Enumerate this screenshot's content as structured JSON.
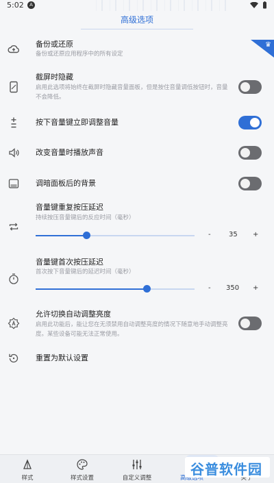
{
  "status_bar": {
    "time": "5:02",
    "app_icon": "A"
  },
  "header": {
    "title": "高级选项"
  },
  "colors": {
    "accent": "#2f6fd6",
    "toggle_off": "#6b6c70",
    "watermark": "#3a8dde"
  },
  "settings": [
    {
      "icon": "cloud-upload-icon",
      "title": "备份或还原",
      "subtitle": "备份或还原应用程序中的所有设定"
    },
    {
      "icon": "phone-screenshot-icon",
      "title": "截屏时隐藏",
      "subtitle": "启用此选项将始终在截屏时隐藏音量面板，但是按住音量调低按钮时，音量不会降低。",
      "toggle": false
    },
    {
      "icon": "plus-minus-icon",
      "title": "按下音量键立即调整音量",
      "toggle": true
    },
    {
      "icon": "speaker-icon",
      "title": "改变音量时播放声音",
      "toggle": false
    },
    {
      "icon": "panel-background-icon",
      "title": "调暗面板后的背景",
      "toggle": false
    },
    {
      "icon": "repeat-icon",
      "title": "音量键重复按压延迟",
      "subtitle": "持续按压音量键后的反应时间（毫秒）",
      "slider": {
        "value": "35",
        "fraction": 0.32,
        "minus": "-",
        "plus": "+"
      }
    },
    {
      "icon": "timer-icon",
      "title": "音量键首次按压延迟",
      "subtitle": "首次按下音量键后的延迟时间（毫秒）",
      "slider": {
        "value": "350",
        "fraction": 0.7,
        "minus": "-",
        "plus": "+"
      }
    },
    {
      "icon": "auto-brightness-icon",
      "title": "允许切换自动调整亮度",
      "subtitle": "启用此功能后，能让您在无须禁用自动调整亮度的情况下随意地手动调整亮度。某些设备可能无法正常使用。",
      "toggle": false
    },
    {
      "icon": "reset-icon",
      "title": "重置为默认设置"
    }
  ],
  "corner_badge": "♛",
  "bottom_nav": [
    {
      "icon": "style-icon",
      "label": "样式",
      "active": false
    },
    {
      "icon": "palette-icon",
      "label": "样式设置",
      "active": false
    },
    {
      "icon": "equalizer-icon",
      "label": "自定义调整",
      "active": false
    },
    {
      "icon": "advanced-icon",
      "label": "高级选项",
      "active": true
    },
    {
      "icon": "about-icon",
      "label": "关于",
      "active": false
    }
  ],
  "watermark": "谷普软件园"
}
